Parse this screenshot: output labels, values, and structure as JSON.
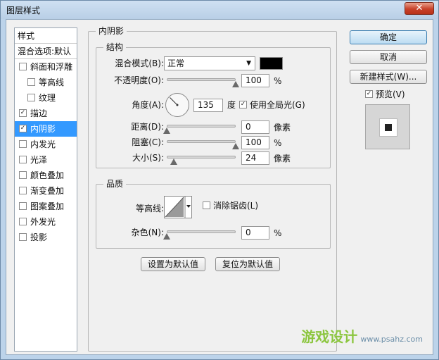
{
  "window": {
    "title": "图层样式",
    "close": "✕"
  },
  "stylelist": {
    "header": "样式",
    "blend_options": "混合选项:默认",
    "items": [
      {
        "label": "斜面和浮雕",
        "checked": false,
        "sub": false,
        "selected": false
      },
      {
        "label": "等高线",
        "checked": false,
        "sub": true,
        "selected": false
      },
      {
        "label": "纹理",
        "checked": false,
        "sub": true,
        "selected": false
      },
      {
        "label": "描边",
        "checked": true,
        "sub": false,
        "selected": false
      },
      {
        "label": "内阴影",
        "checked": true,
        "sub": false,
        "selected": true
      },
      {
        "label": "内发光",
        "checked": false,
        "sub": false,
        "selected": false
      },
      {
        "label": "光泽",
        "checked": false,
        "sub": false,
        "selected": false
      },
      {
        "label": "颜色叠加",
        "checked": false,
        "sub": false,
        "selected": false
      },
      {
        "label": "渐变叠加",
        "checked": false,
        "sub": false,
        "selected": false
      },
      {
        "label": "图案叠加",
        "checked": false,
        "sub": false,
        "selected": false
      },
      {
        "label": "外发光",
        "checked": false,
        "sub": false,
        "selected": false
      },
      {
        "label": "投影",
        "checked": false,
        "sub": false,
        "selected": false
      }
    ]
  },
  "panel": {
    "title": "内阴影",
    "structure": {
      "legend": "结构",
      "blend_mode_label": "混合模式(B):",
      "blend_mode_value": "正常",
      "shadow_color": "#000000",
      "opacity_label": "不透明度(O):",
      "opacity_value": "100",
      "opacity_fraction": 1.0,
      "opacity_unit": "%",
      "angle_label": "角度(A):",
      "angle_value": "135",
      "angle_deg": 135,
      "angle_unit": "度",
      "global_light_label": "使用全局光(G)",
      "global_light_checked": true,
      "distance_label": "距离(D):",
      "distance_value": "0",
      "distance_fraction": 0.0,
      "distance_unit": "像素",
      "choke_label": "阻塞(C):",
      "choke_value": "100",
      "choke_fraction": 1.0,
      "choke_unit": "%",
      "size_label": "大小(S):",
      "size_value": "24",
      "size_fraction": 0.1,
      "size_unit": "像素"
    },
    "quality": {
      "legend": "品质",
      "contour_label": "等高线:",
      "antialias_label": "消除锯齿(L)",
      "antialias_checked": false,
      "noise_label": "杂色(N):",
      "noise_value": "0",
      "noise_fraction": 0.0,
      "noise_unit": "%"
    },
    "make_default": "设置为默认值",
    "reset_default": "复位为默认值"
  },
  "right": {
    "ok": "确定",
    "cancel": "取消",
    "new_style": "新建样式(W)...",
    "preview_label": "预览(V)",
    "preview_checked": true
  },
  "watermark": {
    "text": "游戏设计",
    "site": "www.psahz.com"
  }
}
